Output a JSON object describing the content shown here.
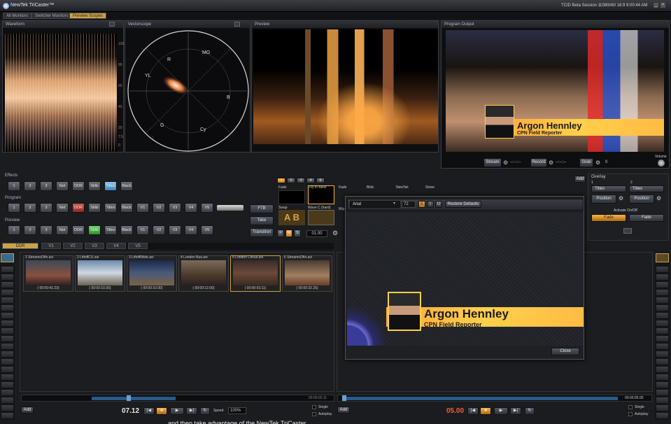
{
  "app": {
    "title": "NewTek TriCaster™",
    "session": "TCID Beta Session 1",
    "format": "1080i/60 16:9",
    "time": "9:00:44 AM"
  },
  "tabs": [
    "All Monitors",
    "Switcher Monitors",
    "Preview Scopes"
  ],
  "panels": {
    "waveform": "Waveform",
    "vectorscope": "Vectorscope",
    "preview": "Preview",
    "program": "Program Output"
  },
  "waveform_scale": [
    "100",
    "80",
    "60",
    "40",
    "20",
    "7.5",
    "0"
  ],
  "vector_labels": [
    "R",
    "MG",
    "B",
    "Cy",
    "G",
    "YL"
  ],
  "output_controls": {
    "stream": "Stream",
    "stream_time": "--:--:--",
    "record": "Record",
    "record_time": "--:--:--",
    "grab": "Grab",
    "grab_count": "0",
    "volume": "Volume"
  },
  "effects": {
    "label": "Effects",
    "buttons": [
      "1",
      "2",
      "3",
      "Net",
      "DDR",
      "Stills",
      "Titles",
      "Black"
    ]
  },
  "program_row": {
    "label": "Program",
    "buttons": [
      "1",
      "2",
      "3",
      "Net",
      "DDR",
      "Stills",
      "Titles",
      "Black",
      "V1",
      "V2",
      "V3",
      "V4",
      "V5"
    ]
  },
  "preview_row": {
    "label": "Preview",
    "buttons": [
      "1",
      "2",
      "3",
      "Net",
      "DDR",
      "Stills",
      "Titles",
      "Black",
      "V1",
      "V2",
      "V3",
      "V4",
      "V5"
    ]
  },
  "tbar": {
    "ftb": "FTB",
    "take": "Take",
    "transition": "Transition",
    "speed": [
      "F",
      "M",
      "S"
    ],
    "duration": "01.00"
  },
  "transition_tabs": [
    "1",
    "2",
    "3",
    "4",
    "5"
  ],
  "transition_names": [
    "Fade",
    "Fly in Back",
    "Swap",
    "Wave C (hard)",
    "Fade",
    "Blob",
    "NewTek",
    "Stone",
    "Wip"
  ],
  "overlay": {
    "label": "Overlay",
    "cols": [
      "1",
      "2"
    ],
    "source1": "Titles",
    "source2": "Titles",
    "position": "Position",
    "activate": "Activate On/Off",
    "fade": "Fade",
    "add": "Add"
  },
  "title_editor": {
    "font": "Arial",
    "size": "72",
    "styles": [
      "B",
      "I",
      "U"
    ],
    "restore": "Restore Defaults",
    "close": "Close"
  },
  "lower_third": {
    "name": "Argon Hennley",
    "subtitle": "CPN Field Reporter"
  },
  "ddr_tabs": [
    "DDR",
    "V1",
    "V2",
    "V3",
    "V4",
    "V5"
  ],
  "clips": [
    {
      "name": "1 StreamsOfIn.avi",
      "duration": "( 00:00:42.23)"
    },
    {
      "name": "2 LiftoffCU.avi",
      "duration": "( 00:00:10.00)"
    },
    {
      "name": "3 LiftoffWide.avi",
      "duration": "( 00:00:10.00)"
    },
    {
      "name": "4 London Bus.avi",
      "duration": "( 00:00:12.00)"
    },
    {
      "name": "5 London Circus.avi",
      "duration": "( 00:00:03.11)"
    },
    {
      "name": "6 StreamsOfIn.avi",
      "duration": "( 00:00:32.25)"
    }
  ],
  "ddr": {
    "clip_time": "00:00:03.11",
    "time": "07.12",
    "speed_label": "Speed",
    "speed": "100%",
    "add": "Add",
    "single": "Single",
    "autoplay": "Autoplay"
  },
  "ddr2": {
    "clip_time": "00:00:05.00",
    "time": "05.00",
    "add": "Add",
    "single": "Single",
    "autoplay": "Autoplay"
  },
  "caption": "and then take advantage of the NewTek TriCaster",
  "colors": {
    "accent": "#c9a24a",
    "red": "#d6584e",
    "green": "#6fdc6a",
    "blue": "#8fc5ee",
    "time_orange": "#ff5a3a"
  }
}
